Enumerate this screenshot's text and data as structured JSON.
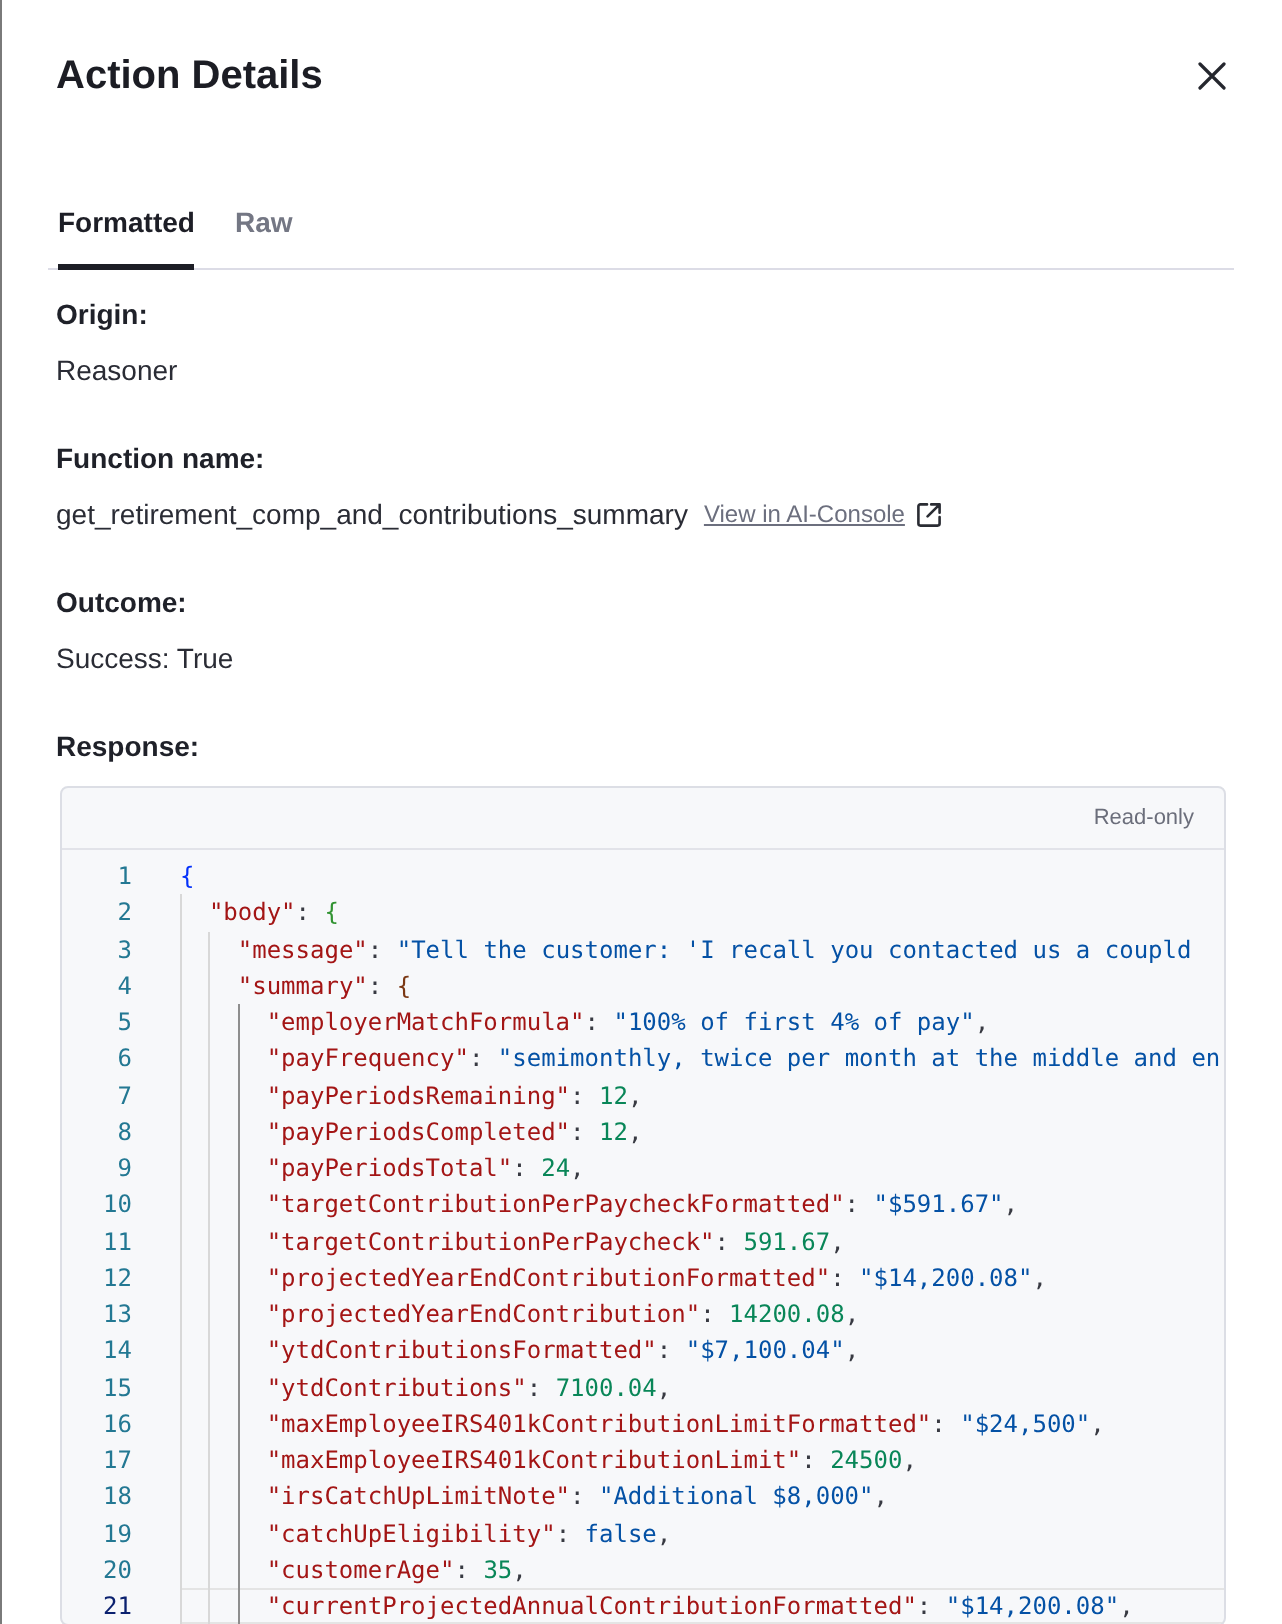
{
  "dialog": {
    "title": "Action Details"
  },
  "tabs": [
    {
      "label": "Formatted",
      "selected": true
    },
    {
      "label": "Raw",
      "selected": false
    }
  ],
  "fields": [
    {
      "label": "Origin:",
      "value": "Reasoner"
    },
    {
      "label": "Function name:",
      "value": "get_retirement_comp_and_contributions_summary",
      "link": "View in AI-Console"
    },
    {
      "label": "Outcome:",
      "value": "Success: True"
    }
  ],
  "response": {
    "label": "Response:",
    "editor": {
      "status": "Read-only",
      "lines": [
        {
          "number": "1",
          "current": false,
          "tokens": [
            {
              "kind": "brace",
              "text": "{"
            }
          ],
          "children": [
            {
              "number": "2",
              "current": false,
              "tokens": [
                {
                  "kind": "key",
                  "text": "\"body\""
                },
                {
                  "kind": "punct",
                  "text": ": "
                },
                {
                  "kind": "brace",
                  "text": "{"
                }
              ],
              "children": [
                {
                  "number": "3",
                  "current": false,
                  "tokens": [
                    {
                      "kind": "key",
                      "text": "\"message\""
                    },
                    {
                      "kind": "punct",
                      "text": ": "
                    },
                    {
                      "kind": "string",
                      "text": "\"Tell the customer: 'I recall you contacted us a coupld"
                    }
                  ]
                },
                {
                  "number": "4",
                  "current": false,
                  "tokens": [
                    {
                      "kind": "key",
                      "text": "\"summary\""
                    },
                    {
                      "kind": "punct",
                      "text": ": "
                    },
                    {
                      "kind": "brace",
                      "text": "{"
                    }
                  ],
                  "children": [
                    {
                      "number": "5",
                      "current": false,
                      "tokens": [
                        {
                          "kind": "key",
                          "text": "\"employerMatchFormula\""
                        },
                        {
                          "kind": "punct",
                          "text": ": "
                        },
                        {
                          "kind": "string",
                          "text": "\"100% of first 4% of pay\""
                        },
                        {
                          "kind": "punct",
                          "text": ","
                        }
                      ]
                    },
                    {
                      "number": "6",
                      "current": false,
                      "tokens": [
                        {
                          "kind": "key",
                          "text": "\"payFrequency\""
                        },
                        {
                          "kind": "punct",
                          "text": ": "
                        },
                        {
                          "kind": "string",
                          "text": "\"semimonthly, twice per month at the middle and en"
                        }
                      ]
                    },
                    {
                      "number": "7",
                      "current": false,
                      "tokens": [
                        {
                          "kind": "key",
                          "text": "\"payPeriodsRemaining\""
                        },
                        {
                          "kind": "punct",
                          "text": ": "
                        },
                        {
                          "kind": "number",
                          "text": "12"
                        },
                        {
                          "kind": "punct",
                          "text": ","
                        }
                      ]
                    },
                    {
                      "number": "8",
                      "current": false,
                      "tokens": [
                        {
                          "kind": "key",
                          "text": "\"payPeriodsCompleted\""
                        },
                        {
                          "kind": "punct",
                          "text": ": "
                        },
                        {
                          "kind": "number",
                          "text": "12"
                        },
                        {
                          "kind": "punct",
                          "text": ","
                        }
                      ]
                    },
                    {
                      "number": "9",
                      "current": false,
                      "tokens": [
                        {
                          "kind": "key",
                          "text": "\"payPeriodsTotal\""
                        },
                        {
                          "kind": "punct",
                          "text": ": "
                        },
                        {
                          "kind": "number",
                          "text": "24"
                        },
                        {
                          "kind": "punct",
                          "text": ","
                        }
                      ]
                    },
                    {
                      "number": "10",
                      "current": false,
                      "tokens": [
                        {
                          "kind": "key",
                          "text": "\"targetContributionPerPaycheckFormatted\""
                        },
                        {
                          "kind": "punct",
                          "text": ": "
                        },
                        {
                          "kind": "string",
                          "text": "\"$591.67\""
                        },
                        {
                          "kind": "punct",
                          "text": ","
                        }
                      ]
                    },
                    {
                      "number": "11",
                      "current": false,
                      "tokens": [
                        {
                          "kind": "key",
                          "text": "\"targetContributionPerPaycheck\""
                        },
                        {
                          "kind": "punct",
                          "text": ": "
                        },
                        {
                          "kind": "number",
                          "text": "591.67"
                        },
                        {
                          "kind": "punct",
                          "text": ","
                        }
                      ]
                    },
                    {
                      "number": "12",
                      "current": false,
                      "tokens": [
                        {
                          "kind": "key",
                          "text": "\"projectedYearEndContributionFormatted\""
                        },
                        {
                          "kind": "punct",
                          "text": ": "
                        },
                        {
                          "kind": "string",
                          "text": "\"$14,200.08\""
                        },
                        {
                          "kind": "punct",
                          "text": ","
                        }
                      ]
                    },
                    {
                      "number": "13",
                      "current": false,
                      "tokens": [
                        {
                          "kind": "key",
                          "text": "\"projectedYearEndContribution\""
                        },
                        {
                          "kind": "punct",
                          "text": ": "
                        },
                        {
                          "kind": "number",
                          "text": "14200.08"
                        },
                        {
                          "kind": "punct",
                          "text": ","
                        }
                      ]
                    },
                    {
                      "number": "14",
                      "current": false,
                      "tokens": [
                        {
                          "kind": "key",
                          "text": "\"ytdContributionsFormatted\""
                        },
                        {
                          "kind": "punct",
                          "text": ": "
                        },
                        {
                          "kind": "string",
                          "text": "\"$7,100.04\""
                        },
                        {
                          "kind": "punct",
                          "text": ","
                        }
                      ]
                    },
                    {
                      "number": "15",
                      "current": false,
                      "tokens": [
                        {
                          "kind": "key",
                          "text": "\"ytdContributions\""
                        },
                        {
                          "kind": "punct",
                          "text": ": "
                        },
                        {
                          "kind": "number",
                          "text": "7100.04"
                        },
                        {
                          "kind": "punct",
                          "text": ","
                        }
                      ]
                    },
                    {
                      "number": "16",
                      "current": false,
                      "tokens": [
                        {
                          "kind": "key",
                          "text": "\"maxEmployeeIRS401kContributionLimitFormatted\""
                        },
                        {
                          "kind": "punct",
                          "text": ": "
                        },
                        {
                          "kind": "string",
                          "text": "\"$24,500\""
                        },
                        {
                          "kind": "punct",
                          "text": ","
                        }
                      ]
                    },
                    {
                      "number": "17",
                      "current": false,
                      "tokens": [
                        {
                          "kind": "key",
                          "text": "\"maxEmployeeIRS401kContributionLimit\""
                        },
                        {
                          "kind": "punct",
                          "text": ": "
                        },
                        {
                          "kind": "number",
                          "text": "24500"
                        },
                        {
                          "kind": "punct",
                          "text": ","
                        }
                      ]
                    },
                    {
                      "number": "18",
                      "current": false,
                      "tokens": [
                        {
                          "kind": "key",
                          "text": "\"irsCatchUpLimitNote\""
                        },
                        {
                          "kind": "punct",
                          "text": ": "
                        },
                        {
                          "kind": "string",
                          "text": "\"Additional $8,000\""
                        },
                        {
                          "kind": "punct",
                          "text": ","
                        }
                      ]
                    },
                    {
                      "number": "19",
                      "current": false,
                      "tokens": [
                        {
                          "kind": "key",
                          "text": "\"catchUpEligibility\""
                        },
                        {
                          "kind": "punct",
                          "text": ": "
                        },
                        {
                          "kind": "boolean",
                          "text": "false"
                        },
                        {
                          "kind": "punct",
                          "text": ","
                        }
                      ]
                    },
                    {
                      "number": "20",
                      "current": false,
                      "tokens": [
                        {
                          "kind": "key",
                          "text": "\"customerAge\""
                        },
                        {
                          "kind": "punct",
                          "text": ": "
                        },
                        {
                          "kind": "number",
                          "text": "35"
                        },
                        {
                          "kind": "punct",
                          "text": ","
                        }
                      ]
                    },
                    {
                      "number": "21",
                      "current": true,
                      "tokens": [
                        {
                          "kind": "key",
                          "text": "\"currentProjectedAnnualContributionFormatted\""
                        },
                        {
                          "kind": "punct",
                          "text": ": "
                        },
                        {
                          "kind": "string",
                          "text": "\"$14,200.08\""
                        },
                        {
                          "kind": "punct",
                          "text": ","
                        }
                      ]
                    }
                  ]
                }
              ]
            }
          ]
        }
      ]
    }
  }
}
